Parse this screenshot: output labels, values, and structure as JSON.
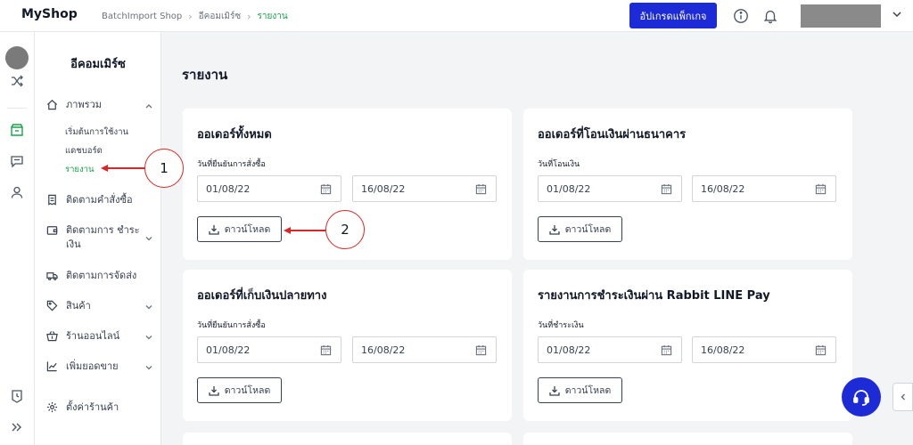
{
  "header": {
    "logo": "MyShop",
    "breadcrumbs": [
      "BatchImport Shop",
      "อีคอมเมิร์ซ",
      "รายงาน"
    ],
    "upgrade_label": "อัปเกรดแพ็กเกจ"
  },
  "sidebar": {
    "title": "อีคอมเมิร์ซ",
    "items": [
      {
        "label": "ภาพรวม",
        "icon": "home-icon",
        "expanded": true
      },
      {
        "label": "ติดตามคำสั่งซื้อ",
        "icon": "receipt-icon"
      },
      {
        "label": "ติดตามการ ชำระเงิน",
        "icon": "wallet-icon"
      },
      {
        "label": "ติดตามการจัดส่ง",
        "icon": "truck-icon"
      },
      {
        "label": "สินค้า",
        "icon": "tag-icon"
      },
      {
        "label": "ร้านออนไลน์",
        "icon": "basket-icon"
      },
      {
        "label": "เพิ่มยอดขาย",
        "icon": "chart-icon"
      },
      {
        "label": "ตั้งค่าร้านค้า",
        "icon": "gear-icon"
      }
    ],
    "subitems": [
      "เริ่มต้นการใช้งาน",
      "แดชบอร์ด",
      "รายงาน"
    ]
  },
  "main": {
    "title": "รายงาน",
    "download_label": "ดาวน์โหลด",
    "cards": [
      {
        "title": "ออเดอร์ทั้งหมด",
        "date_label": "วันที่ยืนยันการสั่งซื้อ",
        "from": "01/08/22",
        "to": "16/08/22"
      },
      {
        "title": "ออเดอร์ที่โอนเงินผ่านธนาคาร",
        "date_label": "วันที่โอนเงิน",
        "from": "01/08/22",
        "to": "16/08/22"
      },
      {
        "title": "ออเดอร์ที่เก็บเงินปลายทาง",
        "date_label": "วันที่ยืนยันการสั่งซื้อ",
        "from": "01/08/22",
        "to": "16/08/22"
      },
      {
        "title": "รายงานการชำระเงินผ่าน Rabbit LINE Pay",
        "date_label": "วันที่ชำระเงิน",
        "from": "01/08/22",
        "to": "16/08/22"
      }
    ]
  },
  "annotations": [
    "1",
    "2"
  ],
  "colors": {
    "accent": "#1d2bd6",
    "active_green": "#16a34a",
    "annotation_red": "#dc2626"
  }
}
